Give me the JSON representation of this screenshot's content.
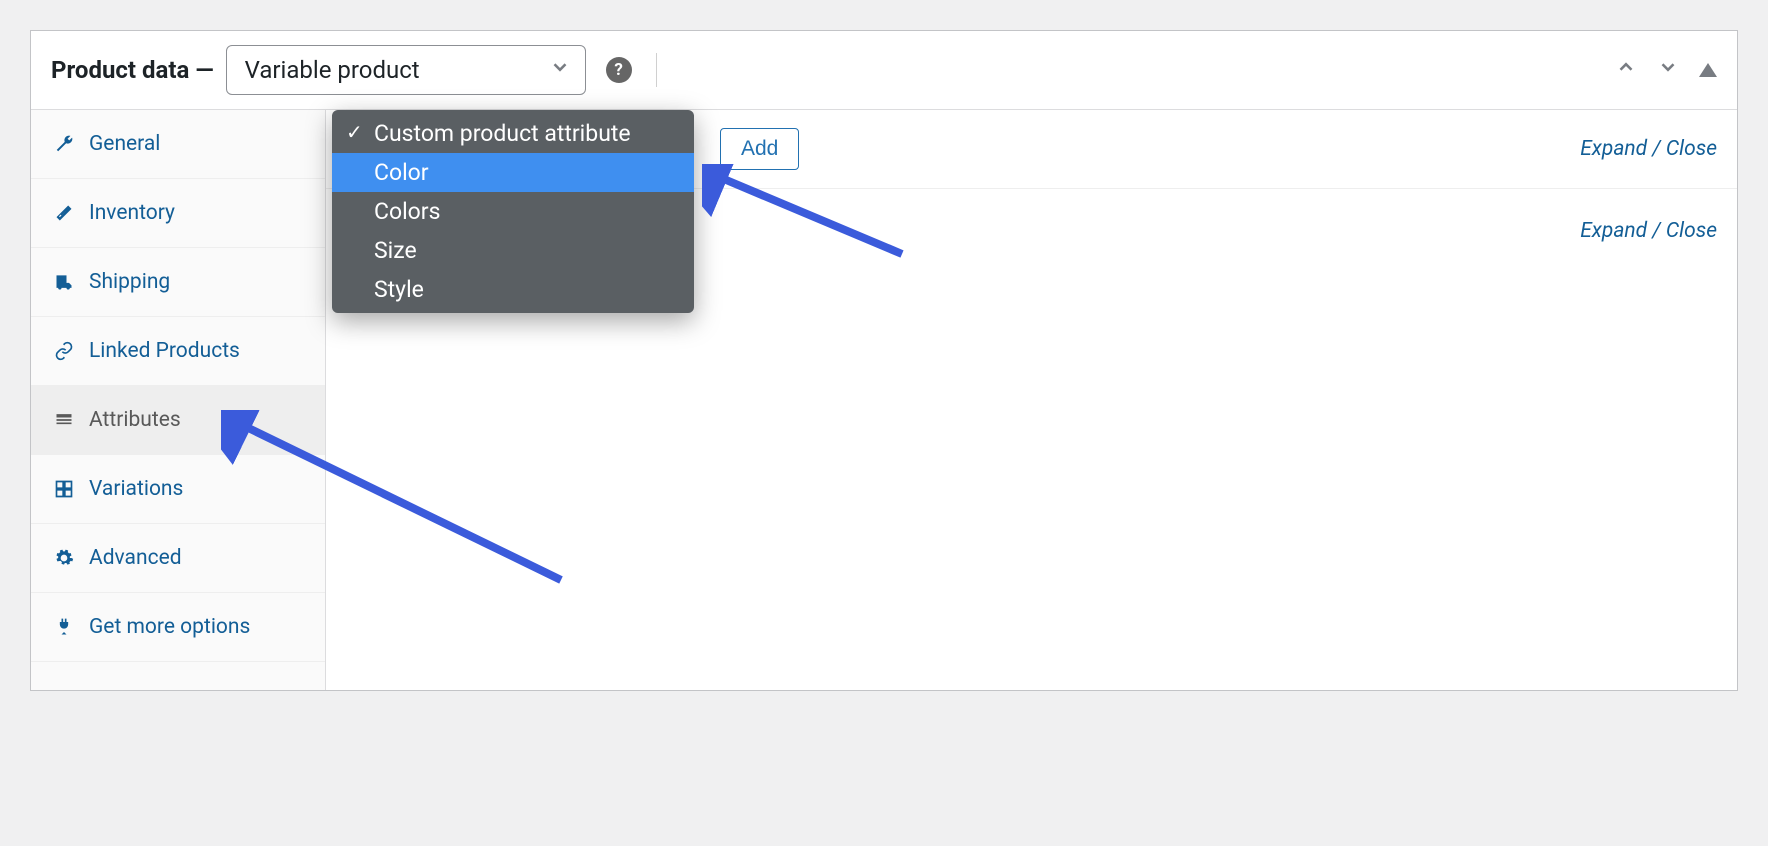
{
  "header": {
    "title": "Product data",
    "dash": "—",
    "product_type": "Variable product"
  },
  "sidebar": {
    "items": [
      {
        "label": "General"
      },
      {
        "label": "Inventory"
      },
      {
        "label": "Shipping"
      },
      {
        "label": "Linked Products"
      },
      {
        "label": "Attributes"
      },
      {
        "label": "Variations"
      },
      {
        "label": "Advanced"
      },
      {
        "label": "Get more options"
      }
    ]
  },
  "toolbar": {
    "add_label": "Add",
    "expand_close": "Expand / Close",
    "expand_close_2": "Expand / Close"
  },
  "dropdown": {
    "items": [
      {
        "label": "Custom product attribute",
        "checked": true
      },
      {
        "label": "Color",
        "highlight": true
      },
      {
        "label": "Colors"
      },
      {
        "label": "Size"
      },
      {
        "label": "Style"
      }
    ]
  }
}
